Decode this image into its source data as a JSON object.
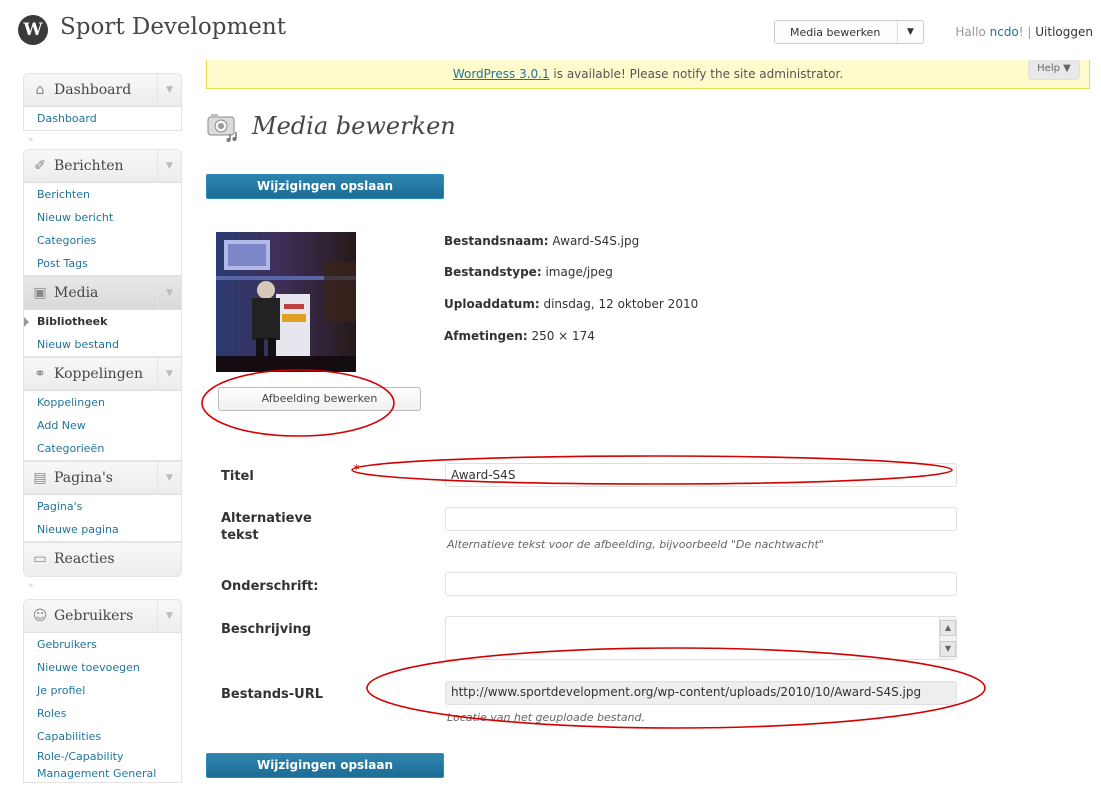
{
  "header": {
    "logo_letter": "W",
    "site_title": "Sport Development",
    "favorite_action": {
      "label": "Media bewerken",
      "arrow": "▼"
    },
    "greeting_prefix": "Hallo ",
    "username": "ncdo",
    "greeting_suffix": "! | ",
    "logout": "Uitloggen"
  },
  "notice": {
    "link_text": "WordPress 3.0.1",
    "text": " is available! Please notify the site administrator.",
    "help": "Help ▼"
  },
  "menu": {
    "dashboard": {
      "label": "Dashboard",
      "icon": "house-icon",
      "items": [
        "Dashboard"
      ]
    },
    "berichten": {
      "label": "Berichten",
      "icon": "pin-icon",
      "items": [
        "Berichten",
        "Nieuw bericht",
        "Categories",
        "Post Tags"
      ]
    },
    "media": {
      "label": "Media",
      "icon": "camera-icon",
      "items": [
        "Bibliotheek",
        "Nieuw bestand"
      ]
    },
    "koppelingen": {
      "label": "Koppelingen",
      "icon": "link-icon",
      "items": [
        "Koppelingen",
        "Add New",
        "Categorieën"
      ]
    },
    "paginas": {
      "label": "Pagina's",
      "icon": "page-icon",
      "items": [
        "Pagina's",
        "Nieuwe pagina"
      ]
    },
    "reacties": {
      "label": "Reacties",
      "icon": "speech-bubble-icon"
    },
    "gebruikers": {
      "label": "Gebruikers",
      "icon": "users-icon",
      "items": [
        "Gebruikers",
        "Nieuwe toevoegen",
        "Je profiel",
        "Roles",
        "Capabilities",
        "Role-/Capability",
        "Management General"
      ]
    },
    "toggle_glyph": "▼",
    "separator_glyph": "«"
  },
  "page": {
    "title": "Media bewerken",
    "save_button": "Wijzigingen opslaan",
    "edit_image_button": "Afbeelding bewerken"
  },
  "meta": {
    "filename_label": "Bestandsnaam:",
    "filename": "Award-S4S.jpg",
    "filetype_label": "Bestandstype:",
    "filetype": "image/jpeg",
    "upload_label": "Uploaddatum:",
    "upload_date": "dinsdag, 12 oktober 2010",
    "dimensions_label": "Afmetingen:",
    "dimensions": "250 × 174"
  },
  "form": {
    "title_label": "Titel",
    "title_value": "Award-S4S",
    "required_mark": "*",
    "alt_label_1": "Alternatieve",
    "alt_label_2": "tekst",
    "alt_value": "",
    "alt_help": "Alternatieve tekst voor de afbeelding, bijvoorbeeld \"De nachtwacht\"",
    "caption_label": "Onderschrift:",
    "caption_value": "",
    "description_label": "Beschrijving",
    "url_label": "Bestands-URL",
    "url_value": "http://www.sportdevelopment.org/wp-content/uploads/2010/10/Award-S4S.jpg",
    "url_help": "Locatie van het geuploade bestand."
  },
  "colors": {
    "link": "#21759b",
    "primary_button": "#21759b",
    "annotation": "#d40000",
    "notice_bg": "#fffbcc"
  }
}
